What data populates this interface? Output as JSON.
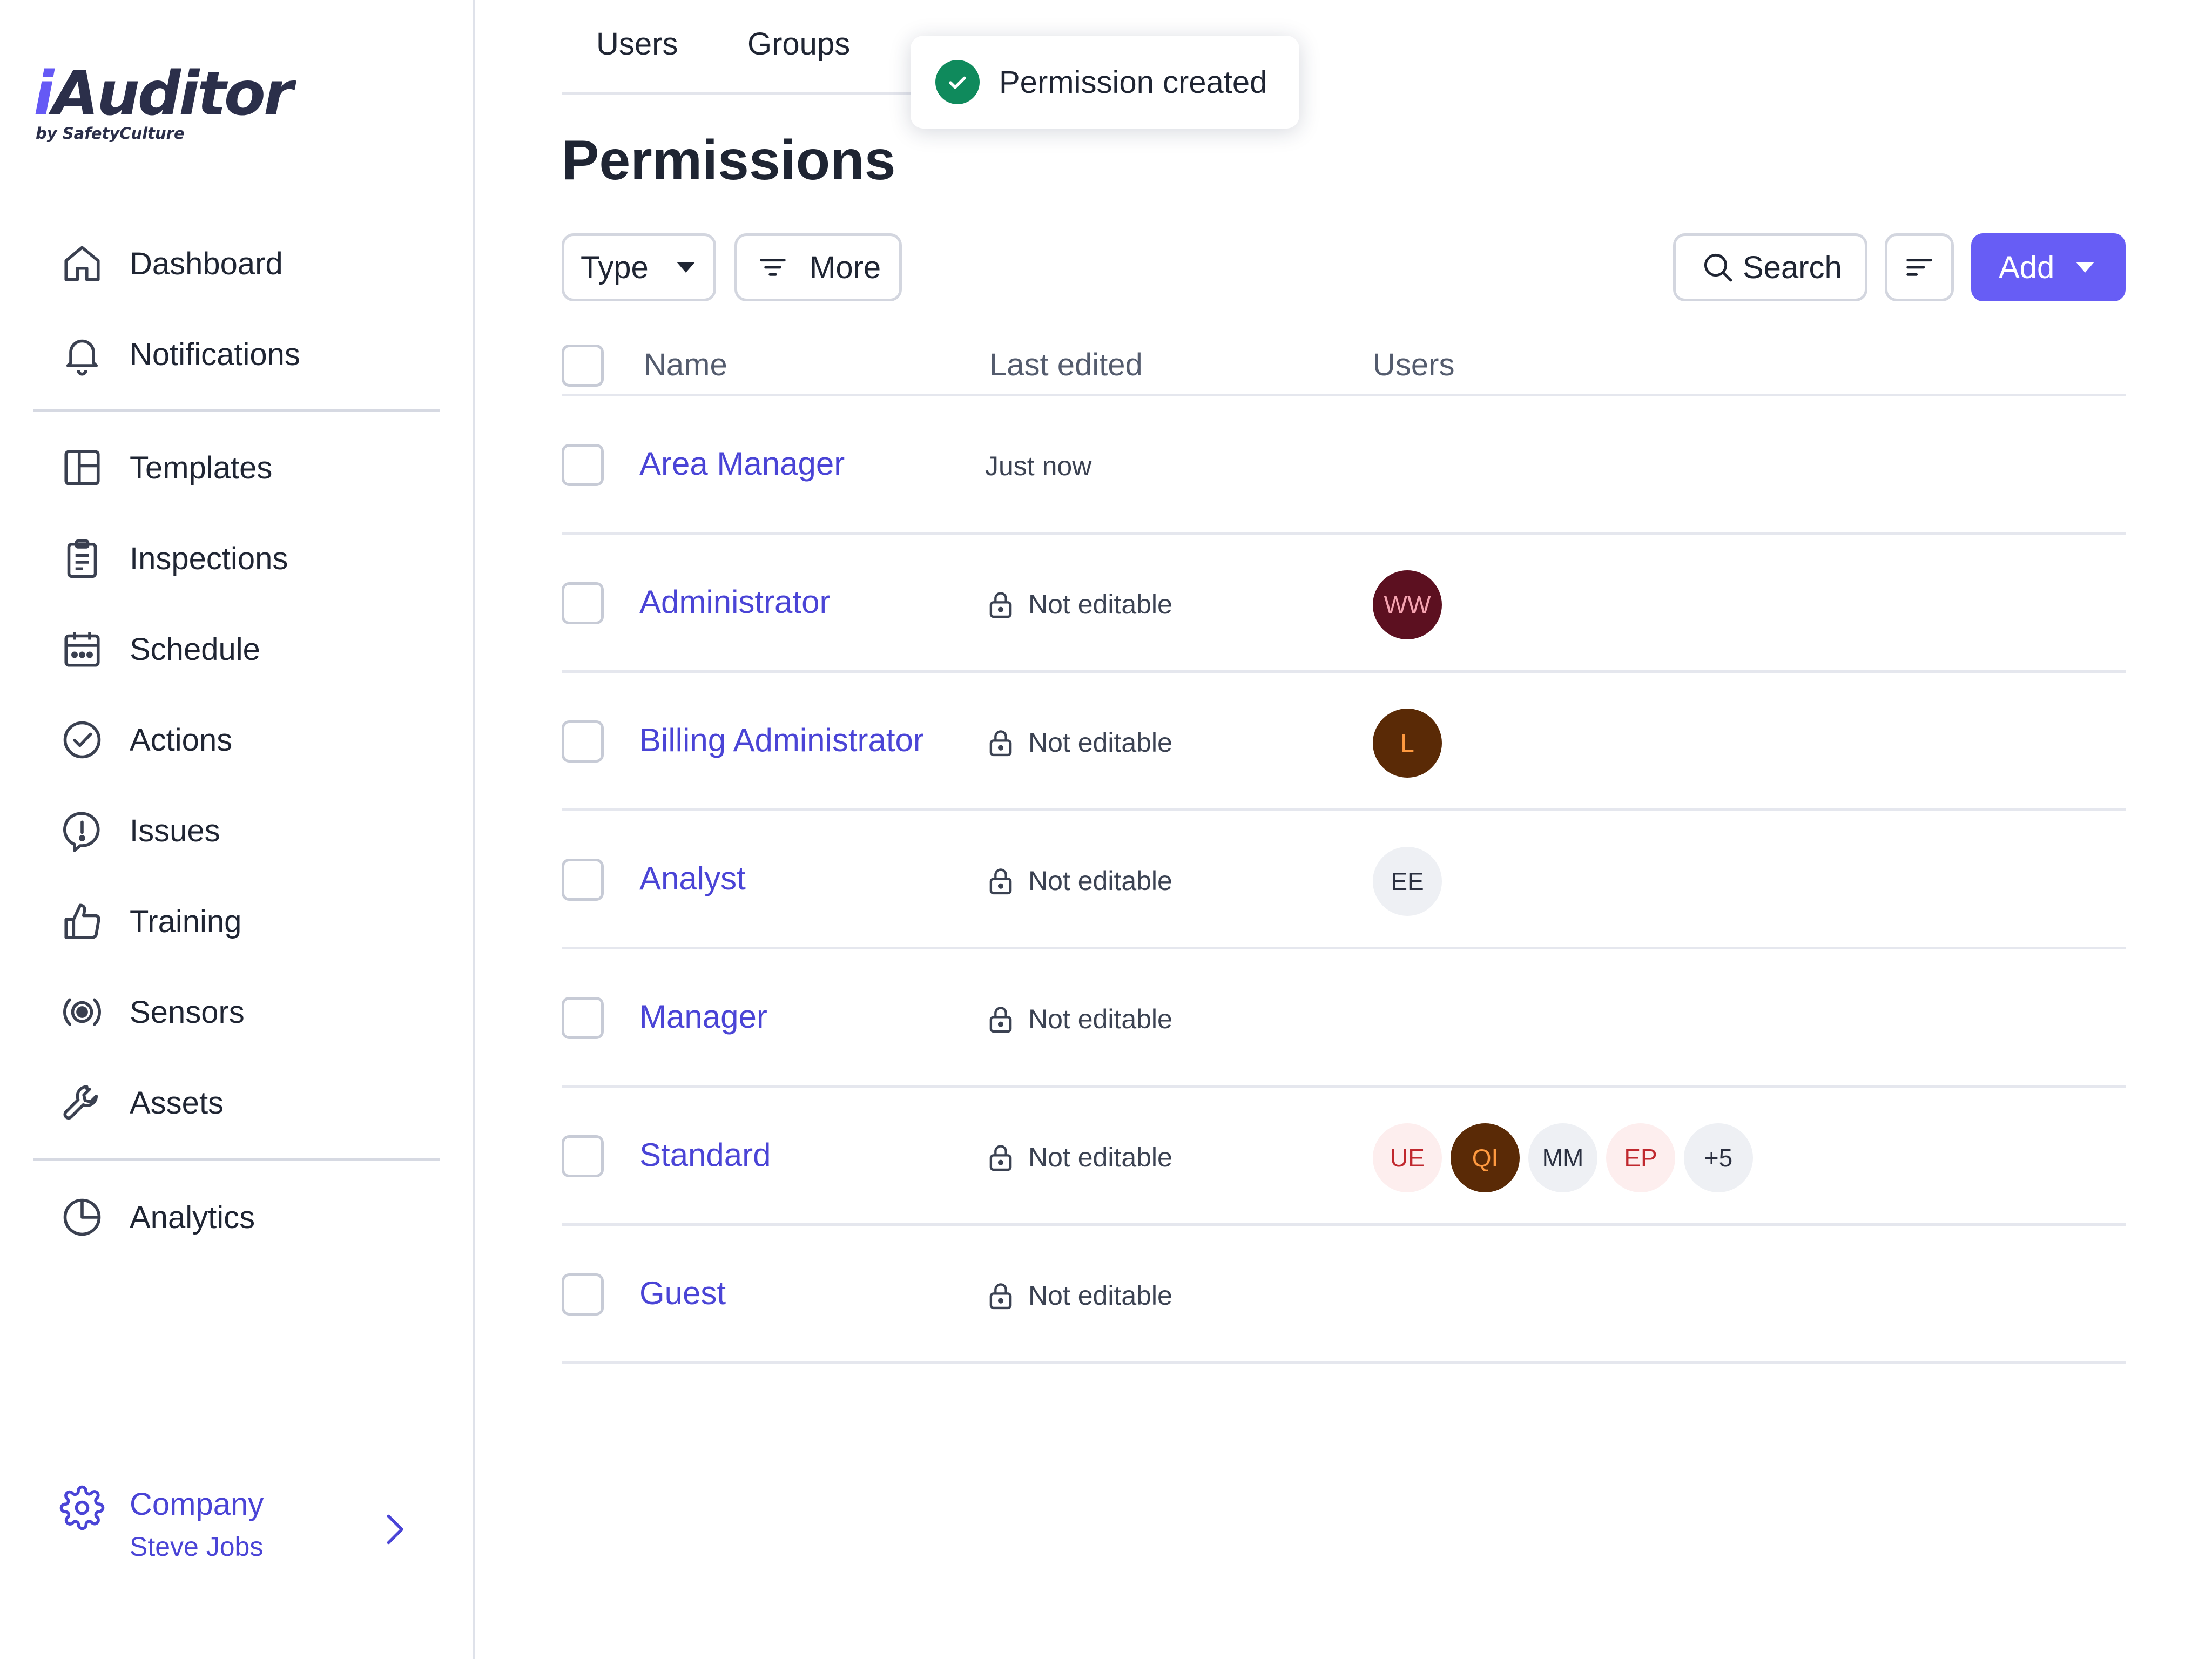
{
  "brand": {
    "logo_main_i": "i",
    "logo_main_rest": "Auditor",
    "logo_sub": "by SafetyCulture",
    "accent": "#675df5"
  },
  "sidebar": {
    "items": [
      {
        "label": "Dashboard",
        "icon": "home-icon"
      },
      {
        "label": "Notifications",
        "icon": "bell-icon"
      },
      {
        "label": "Templates",
        "icon": "template-icon"
      },
      {
        "label": "Inspections",
        "icon": "clipboard-icon"
      },
      {
        "label": "Schedule",
        "icon": "calendar-icon"
      },
      {
        "label": "Actions",
        "icon": "check-circle-icon"
      },
      {
        "label": "Issues",
        "icon": "issue-icon"
      },
      {
        "label": "Training",
        "icon": "thumbs-up-icon"
      },
      {
        "label": "Sensors",
        "icon": "sensor-icon"
      },
      {
        "label": "Assets",
        "icon": "wrench-icon"
      },
      {
        "label": "Analytics",
        "icon": "pie-chart-icon"
      }
    ],
    "company": {
      "name": "Company",
      "user": "Steve Jobs",
      "icon": "gear-icon"
    }
  },
  "tabs": [
    {
      "label": "Users"
    },
    {
      "label": "Groups"
    }
  ],
  "toast": {
    "text": "Permission created",
    "color": "#0f8a5c"
  },
  "page": {
    "title": "Permissions"
  },
  "toolbar": {
    "type_label": "Type",
    "more_label": "More",
    "search_label": "Search",
    "add_label": "Add"
  },
  "table": {
    "headers": {
      "name": "Name",
      "last_edited": "Last edited",
      "users": "Users"
    },
    "rows": [
      {
        "name": "Area Manager",
        "last_edited": "Just now",
        "locked": false,
        "users": []
      },
      {
        "name": "Administrator",
        "last_edited": "Not editable",
        "locked": true,
        "users": [
          {
            "initials": "WW",
            "bg": "#5c1020",
            "fg": "#f5a3b0"
          }
        ]
      },
      {
        "name": "Billing Administrator",
        "last_edited": "Not editable",
        "locked": true,
        "users": [
          {
            "initials": "L",
            "bg": "#5a2a06",
            "fg": "#ff9a40"
          }
        ]
      },
      {
        "name": "Analyst",
        "last_edited": "Not editable",
        "locked": true,
        "users": [
          {
            "initials": "EE",
            "bg": "#eef0f4",
            "fg": "#2b3040"
          }
        ]
      },
      {
        "name": "Manager",
        "last_edited": "Not editable",
        "locked": true,
        "users": []
      },
      {
        "name": "Standard",
        "last_edited": "Not editable",
        "locked": true,
        "users": [
          {
            "initials": "UE",
            "bg": "#fdeeee",
            "fg": "#c0282e"
          },
          {
            "initials": "QI",
            "bg": "#5a2a06",
            "fg": "#ff9a40"
          },
          {
            "initials": "MM",
            "bg": "#eef0f4",
            "fg": "#2b3040"
          },
          {
            "initials": "EP",
            "bg": "#fdeeee",
            "fg": "#c0282e"
          },
          {
            "initials": "+5",
            "bg": "#eef0f4",
            "fg": "#2b3040"
          }
        ]
      },
      {
        "name": "Guest",
        "last_edited": "Not editable",
        "locked": true,
        "users": []
      }
    ]
  }
}
